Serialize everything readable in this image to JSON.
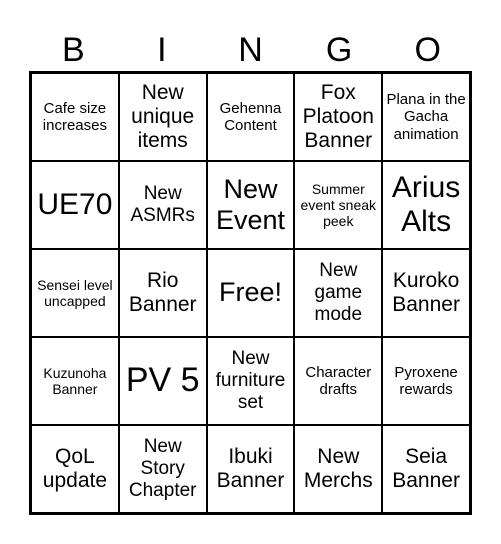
{
  "header": [
    "B",
    "I",
    "N",
    "G",
    "O"
  ],
  "cells": [
    "Cafe size increases",
    "New unique items",
    "Gehenna Content",
    "Fox Platoon Banner",
    "Plana in the Gacha animation",
    "UE70",
    "New ASMRs",
    "New Event",
    "Summer event sneak peek",
    "Arius Alts",
    "Sensei level uncapped",
    "Rio Banner",
    "Free!",
    "New game mode",
    "Kuroko Banner",
    "Kuzunoha Banner",
    "PV 5",
    "New furniture set",
    "Character drafts",
    "Pyroxene rewards",
    "QoL update",
    "New Story Chapter",
    "Ibuki Banner",
    "New Merchs",
    "Seia Banner"
  ]
}
